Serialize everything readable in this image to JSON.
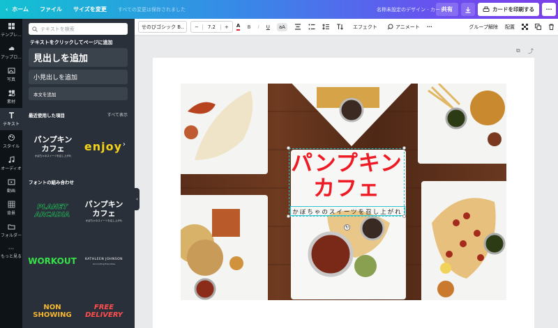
{
  "topbar": {
    "home_label": "ホーム",
    "file_label": "ファイル",
    "resize_label": "サイズを変更",
    "save_status": "すべての変更は保存されました",
    "doc_title": "名称未設定のデザイン - カード",
    "share_label": "共有",
    "print_label": "カードを印刷する",
    "more_label": "···"
  },
  "rail": {
    "items": [
      {
        "label": "テンプレ...",
        "icon": "template-icon"
      },
      {
        "label": "アップロ...",
        "icon": "upload-icon"
      },
      {
        "label": "写真",
        "icon": "photo-icon"
      },
      {
        "label": "素材",
        "icon": "elements-icon"
      },
      {
        "label": "テキスト",
        "icon": "text-icon"
      },
      {
        "label": "スタイル",
        "icon": "style-icon"
      },
      {
        "label": "オーディオ",
        "icon": "audio-icon"
      },
      {
        "label": "動画",
        "icon": "video-icon"
      },
      {
        "label": "背景",
        "icon": "background-icon"
      },
      {
        "label": "フォルダー",
        "icon": "folder-icon"
      },
      {
        "label": "もっと見る",
        "icon": "more-icon"
      }
    ]
  },
  "panel": {
    "search_placeholder": "テキストを検索",
    "hint": "テキストをクリックしてページに追加",
    "add_heading": "見出しを追加",
    "add_subheading": "小見出しを追加",
    "add_body": "本文を追加",
    "recent_title": "最近使用した項目",
    "see_all": "すべて表示",
    "combos_title": "フォントの組み合わせ",
    "recent_tiles": [
      {
        "main": "パンプキン\nカフェ",
        "sub": "かぼちゃのスイーツを召し上がれ"
      },
      {
        "main": "enjoy"
      }
    ],
    "combo_tiles": [
      {
        "main": "PLANET\nARCADIA"
      },
      {
        "main": "パンプキン\nカフェ",
        "sub": "かぼちゃのスイーツを召し上がれ"
      },
      {
        "main": "WORKOUT"
      },
      {
        "main": "KATHLEEN JOHNSON",
        "sub": "Accounting Executive"
      },
      {
        "main": "NON\nSHOWING"
      },
      {
        "main": "FREE\nDELIVERY"
      }
    ]
  },
  "toolbar": {
    "font_name": "せのびゴシック B...",
    "font_size": "7.2",
    "minus": "−",
    "plus": "+",
    "bold": "B",
    "italic": "I",
    "underline": "U",
    "case": "aA",
    "effects": "エフェクト",
    "animate": "アニメート",
    "more": "···",
    "ungroup": "グループ解除",
    "arrange": "配置"
  },
  "canvas": {
    "headline": "パンプキン\nカフェ",
    "tagline": "かぼちゃのスイーツを召し上がれ"
  },
  "colors": {
    "accent_red": "#ee1a24",
    "selection": "#2ec5d2",
    "panel_bg": "#293039",
    "rail_bg": "#0e1318"
  }
}
